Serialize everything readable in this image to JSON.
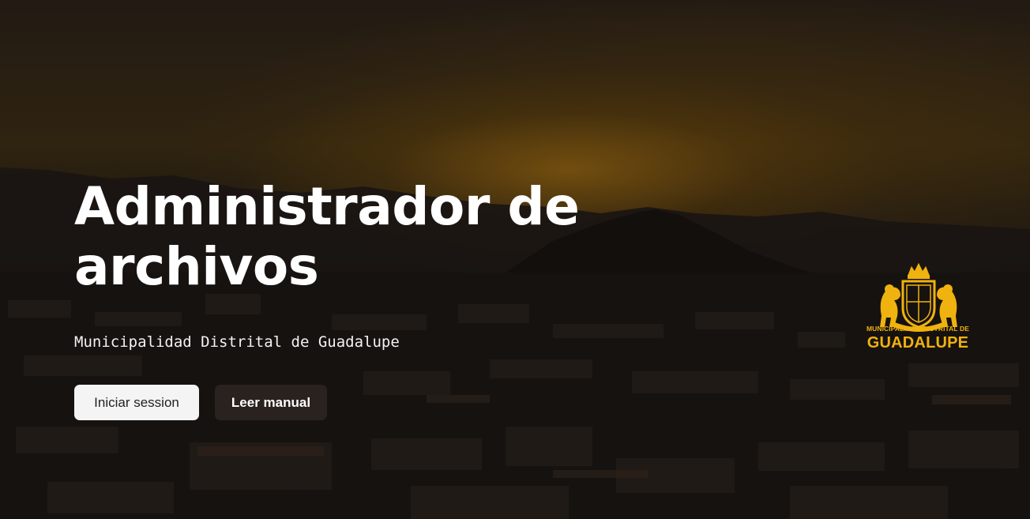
{
  "hero": {
    "title": "Administrador de archivos",
    "subtitle": "Municipalidad Distrital de Guadalupe"
  },
  "buttons": {
    "login_label": "Iniciar session",
    "manual_label": "Leer manual"
  },
  "logo": {
    "line1": "MUNICIPALIDAD DISTRITAL DE",
    "line2": "GUADALUPE",
    "icon": "coat-of-arms-icon"
  },
  "colors": {
    "accent_gold": "#f0b20f",
    "button_light": "#f4f4f4",
    "button_dark": "#2a221e",
    "text_white": "#ffffff"
  }
}
